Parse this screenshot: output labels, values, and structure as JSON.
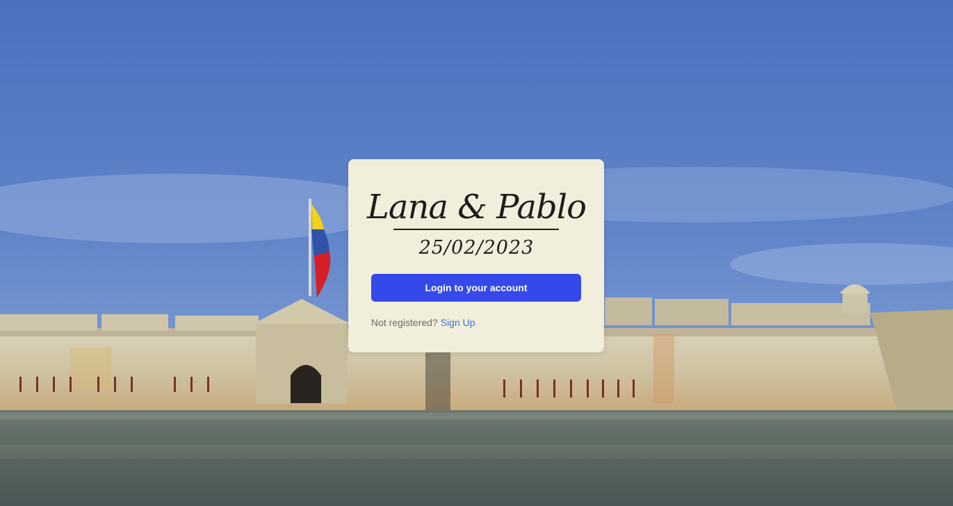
{
  "background": {
    "sky_top": "#4b72bf",
    "sky_bottom": "#7d9cd4",
    "wall_color": "#d8cdb0",
    "water_color": "#5b6a6a",
    "flag_colors": [
      "#f2d21a",
      "#2e53a8",
      "#d61f26"
    ]
  },
  "card": {
    "names": "Lana & Pablo",
    "date": "25/02/2023",
    "login_button_label": "Login to your account",
    "not_registered_text": "Not registered?",
    "signup_link_label": "Sign Up"
  },
  "colors": {
    "card_bg": "#f1eedb",
    "button_bg": "#3549ea",
    "link": "#3d6fe0"
  }
}
